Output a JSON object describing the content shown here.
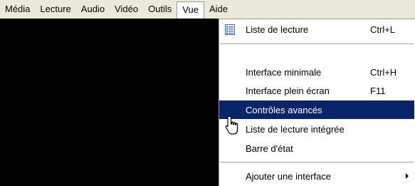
{
  "menubar": {
    "items": [
      "Média",
      "Lecture",
      "Audio",
      "Vidéo",
      "Outils",
      "Vue",
      "Aide"
    ]
  },
  "menu": {
    "playlist": {
      "label": "Liste de lecture",
      "shortcut": "Ctrl+L",
      "icon": "playlist-icon"
    },
    "minimal": {
      "label": "Interface minimale",
      "shortcut": "Ctrl+H"
    },
    "fullscreen": {
      "label": "Interface plein écran",
      "shortcut": "F11"
    },
    "advanced": {
      "label": "Contrôles avancés"
    },
    "docked_playlist": {
      "label": "Liste de lecture intégrée",
      "checked": true
    },
    "status_bar": {
      "label": "Barre d'état"
    },
    "add_interface": {
      "label": "Ajouter une interface",
      "submenu": true
    }
  },
  "colors": {
    "highlight": "#0a246a",
    "menu_bg": "#ece9d8",
    "video_bg": "#000000"
  }
}
